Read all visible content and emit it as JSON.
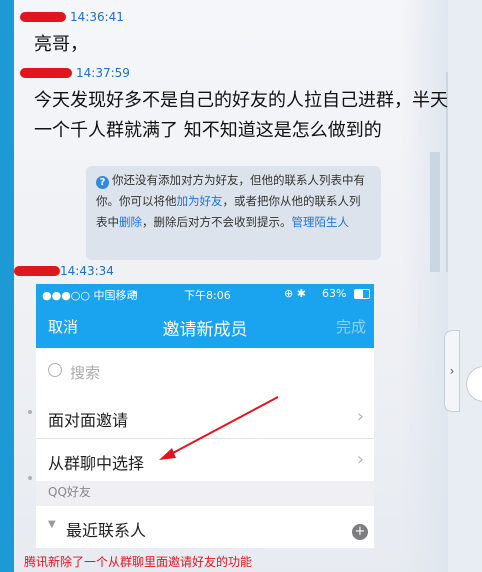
{
  "messages": [
    {
      "time": "14:36:41",
      "text": "亮哥，"
    },
    {
      "time": "14:37:59",
      "text": "今天发现好多不是自己的好友的人拉自己进群，半天一个千人群就满了 知不知道这是怎么做到的"
    }
  ],
  "notice": {
    "part1": "你还没有添加对方为好友，但他的联系人列表中有你。你可以将他",
    "link1": "加为好友",
    "part2": "，或者把你从他的联系人列表中",
    "link2": "删除",
    "part3": "，删除后对方不会收到提示。",
    "link3": "管理陌生人"
  },
  "image_message": {
    "time": "14:43:34",
    "status_bar": {
      "carrier": "●●●○○ 中国移动",
      "time": "下午8:06",
      "battery": "63%"
    },
    "nav": {
      "cancel": "取消",
      "title": "邀请新成员",
      "done": "完成"
    },
    "search_placeholder": "搜索",
    "rows": [
      "面对面邀请",
      "从群聊中选择"
    ],
    "section": "QQ好友",
    "group": "最近联系人"
  },
  "caption": "腾讯新除了一个从群聊里面邀请好友的功能",
  "colors": {
    "accent": "#1aa3ee",
    "link": "#1d74d6",
    "highlight": "#e0161f"
  }
}
